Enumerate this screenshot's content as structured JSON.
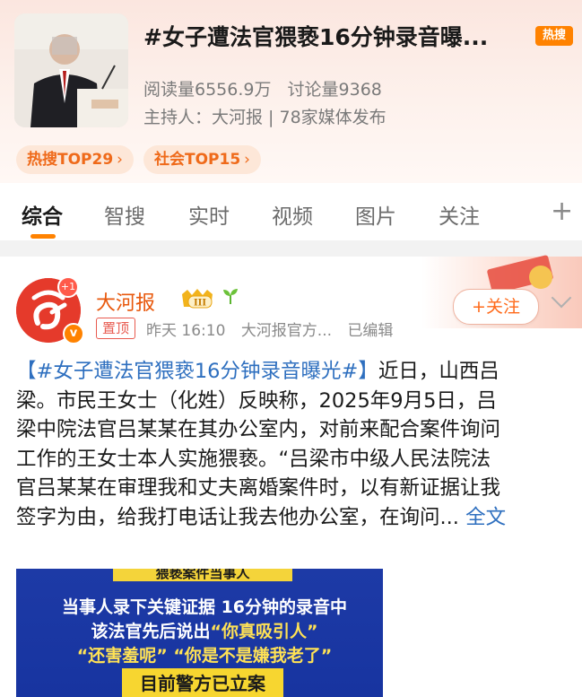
{
  "topic": {
    "title": "#女子遭法官猥亵16分钟录音曝...",
    "hot_tag": "热搜",
    "reads": "阅读量6556.9万",
    "discussions": "讨论量9368",
    "host": "主持人：大河报 | 78家媒体发布",
    "ranks": [
      {
        "label": "热搜TOP29",
        "chev": "›"
      },
      {
        "label": "社会TOP15",
        "chev": "›"
      }
    ]
  },
  "tabs": [
    {
      "label": "综合",
      "active": true
    },
    {
      "label": "智搜",
      "active": false
    },
    {
      "label": "实时",
      "active": false
    },
    {
      "label": "视频",
      "active": false
    },
    {
      "label": "图片",
      "active": false
    },
    {
      "label": "关注",
      "active": false
    }
  ],
  "tabs_plus": "+",
  "post": {
    "author": "大河报",
    "badge_level": "III",
    "avatar_badge": "+1",
    "verified": "v",
    "pin": "置顶",
    "time": "昨天 16:10",
    "source": "大河报官方...",
    "edited": "已编辑",
    "follow": "+关注",
    "text": {
      "hashtag": "【#女子遭法官猥亵16分钟录音曝光#】",
      "l1_rest": "近日，山西吕",
      "l2": "梁。市民王女士（化姓）反映称，2025年9月5日，吕",
      "l3": "梁中院法官吕某某在其办公室内，对前来配合案件询问",
      "l4": "工作的王女士本人实施猥亵。“吕梁市中级人民法院法",
      "l5": "官吕某某在审理我和丈夫离婚案件时，以有新证据让我",
      "l6": "签字为由，给我打电话让我去他办公室，在询问...",
      "full": "全文"
    },
    "media": {
      "top": "猥亵案件当事人",
      "l1": "当事人录下关键证据 16分钟的录音中",
      "l2_a": "该法官先后说出",
      "l2_q": "“你真吸引人”",
      "l3_q1": "“还害羞呢”",
      "l3_q2": "“你是不是嫌我老了”",
      "banner": "目前警方已立案"
    }
  },
  "colors": {
    "accent": "#ff8200",
    "author": "#e8580c",
    "link": "#2e6fbf",
    "header_bg": "#fbe6df",
    "media_bg": "#1d3aa6",
    "media_yellow": "#f7d630"
  }
}
